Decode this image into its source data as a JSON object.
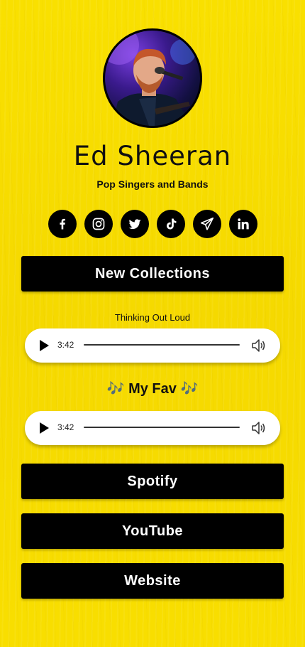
{
  "profile": {
    "name": "Ed Sheeran",
    "subtitle": "Pop Singers and Bands"
  },
  "socials": [
    {
      "icon": "facebook-icon"
    },
    {
      "icon": "instagram-icon"
    },
    {
      "icon": "twitter-icon"
    },
    {
      "icon": "tiktok-icon"
    },
    {
      "icon": "telegram-icon"
    },
    {
      "icon": "linkedin-icon"
    }
  ],
  "buttons": {
    "collections": "New Collections",
    "spotify": "Spotify",
    "youtube": "YouTube",
    "website": "Website"
  },
  "tracks": [
    {
      "title": "Thinking Out Loud",
      "time": "3:42"
    },
    {
      "title": "🎶 My Fav 🎶",
      "time": "3:42"
    }
  ],
  "colors": {
    "background": "#f7dc00",
    "button": "#000000",
    "button_text": "#ffffff"
  }
}
